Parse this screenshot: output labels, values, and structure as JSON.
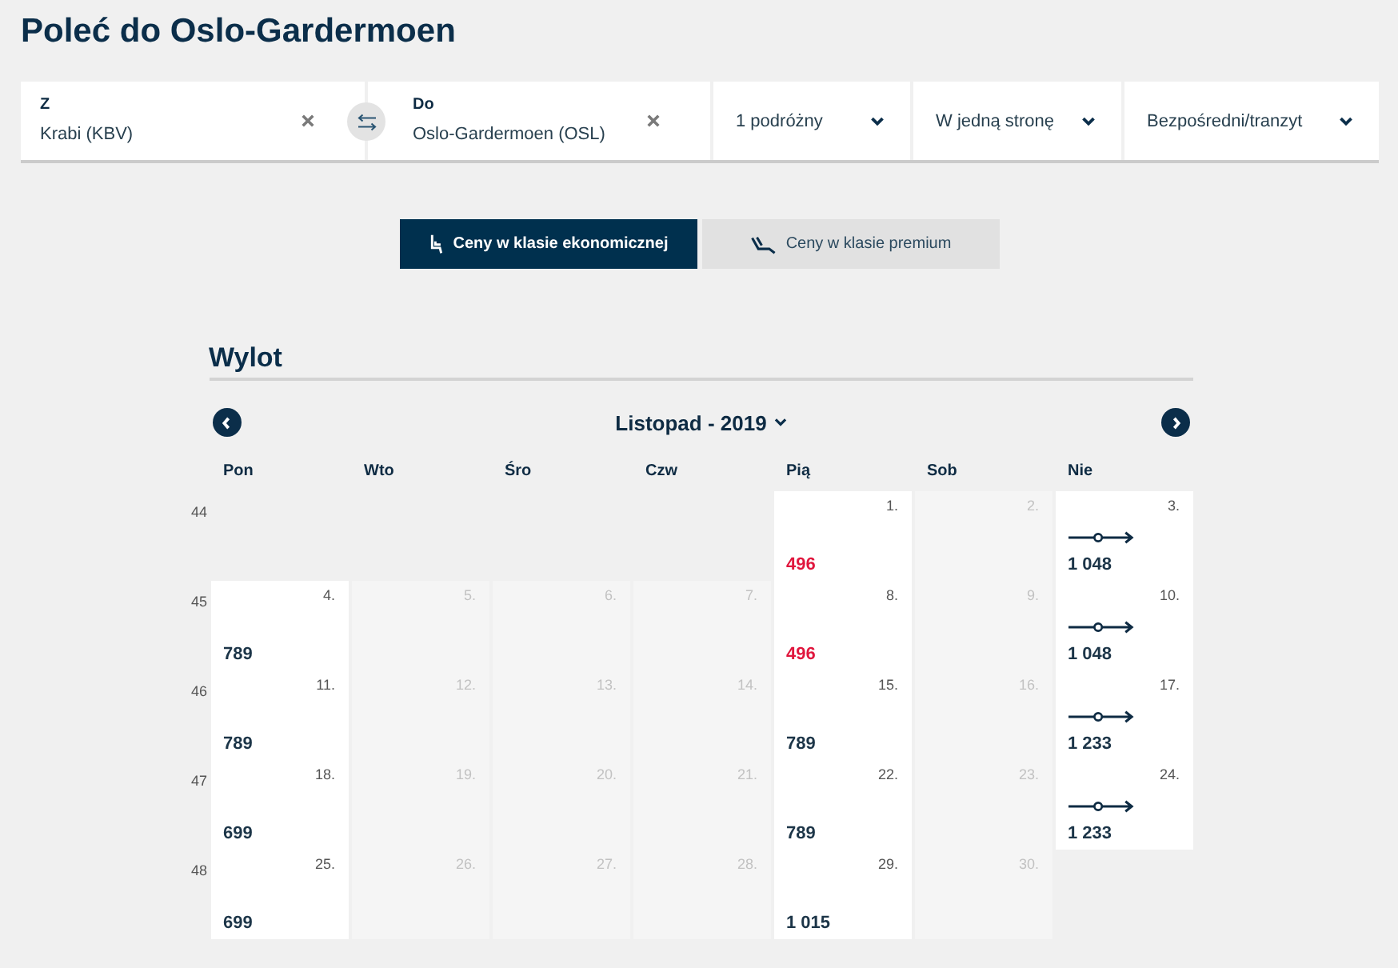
{
  "title": "Poleć do Oslo-Gardermoen",
  "search_bar": {
    "from": {
      "label": "Z",
      "value": "Krabi (KBV)"
    },
    "to": {
      "label": "Do",
      "value": "Oslo-Gardermoen (OSL)"
    },
    "dropdowns": [
      {
        "label": "1 podróżny"
      },
      {
        "label": "W jedną stronę"
      },
      {
        "label": "Bezpośredni/tranzyt"
      }
    ]
  },
  "fare_tabs": [
    {
      "label": "Ceny w klasie ekonomicznej",
      "kind": "economy",
      "selected": true
    },
    {
      "label": "Ceny w klasie premium",
      "kind": "premium",
      "selected": false
    }
  ],
  "calendar": {
    "title": "Wylot",
    "month": "Listopad - 2019",
    "weekdays": [
      "Pon",
      "Wto",
      "Śro",
      "Czw",
      "Pią",
      "Sob",
      "Nie"
    ],
    "weeks": [
      {
        "number": "44",
        "days": [
          {
            "kind": "blank"
          },
          {
            "kind": "blank"
          },
          {
            "kind": "blank"
          },
          {
            "kind": "blank"
          },
          {
            "kind": "available",
            "day": "1.",
            "price": "496",
            "lowest": true,
            "stopover": false
          },
          {
            "kind": "unavailable",
            "day": "2."
          },
          {
            "kind": "available",
            "day": "3.",
            "price": "1 048",
            "lowest": false,
            "stopover": true
          }
        ]
      },
      {
        "number": "45",
        "days": [
          {
            "kind": "available",
            "day": "4.",
            "price": "789",
            "lowest": false,
            "stopover": false
          },
          {
            "kind": "unavailable",
            "day": "5."
          },
          {
            "kind": "unavailable",
            "day": "6."
          },
          {
            "kind": "unavailable",
            "day": "7."
          },
          {
            "kind": "available",
            "day": "8.",
            "price": "496",
            "lowest": true,
            "stopover": false
          },
          {
            "kind": "unavailable",
            "day": "9."
          },
          {
            "kind": "available",
            "day": "10.",
            "price": "1 048",
            "lowest": false,
            "stopover": true
          }
        ]
      },
      {
        "number": "46",
        "days": [
          {
            "kind": "available",
            "day": "11.",
            "price": "789",
            "lowest": false,
            "stopover": false
          },
          {
            "kind": "unavailable",
            "day": "12."
          },
          {
            "kind": "unavailable",
            "day": "13."
          },
          {
            "kind": "unavailable",
            "day": "14."
          },
          {
            "kind": "available",
            "day": "15.",
            "price": "789",
            "lowest": false,
            "stopover": false
          },
          {
            "kind": "unavailable",
            "day": "16."
          },
          {
            "kind": "available",
            "day": "17.",
            "price": "1 233",
            "lowest": false,
            "stopover": true
          }
        ]
      },
      {
        "number": "47",
        "days": [
          {
            "kind": "available",
            "day": "18.",
            "price": "699",
            "lowest": false,
            "stopover": false
          },
          {
            "kind": "unavailable",
            "day": "19."
          },
          {
            "kind": "unavailable",
            "day": "20."
          },
          {
            "kind": "unavailable",
            "day": "21."
          },
          {
            "kind": "available",
            "day": "22.",
            "price": "789",
            "lowest": false,
            "stopover": false
          },
          {
            "kind": "unavailable",
            "day": "23."
          },
          {
            "kind": "available",
            "day": "24.",
            "price": "1 233",
            "lowest": false,
            "stopover": true
          }
        ]
      },
      {
        "number": "48",
        "days": [
          {
            "kind": "available",
            "day": "25.",
            "price": "699",
            "lowest": false,
            "stopover": false
          },
          {
            "kind": "unavailable",
            "day": "26."
          },
          {
            "kind": "unavailable",
            "day": "27."
          },
          {
            "kind": "unavailable",
            "day": "28."
          },
          {
            "kind": "available",
            "day": "29.",
            "price": "1 015",
            "lowest": false,
            "stopover": false
          },
          {
            "kind": "unavailable",
            "day": "30."
          },
          {
            "kind": "blank"
          }
        ]
      }
    ]
  }
}
